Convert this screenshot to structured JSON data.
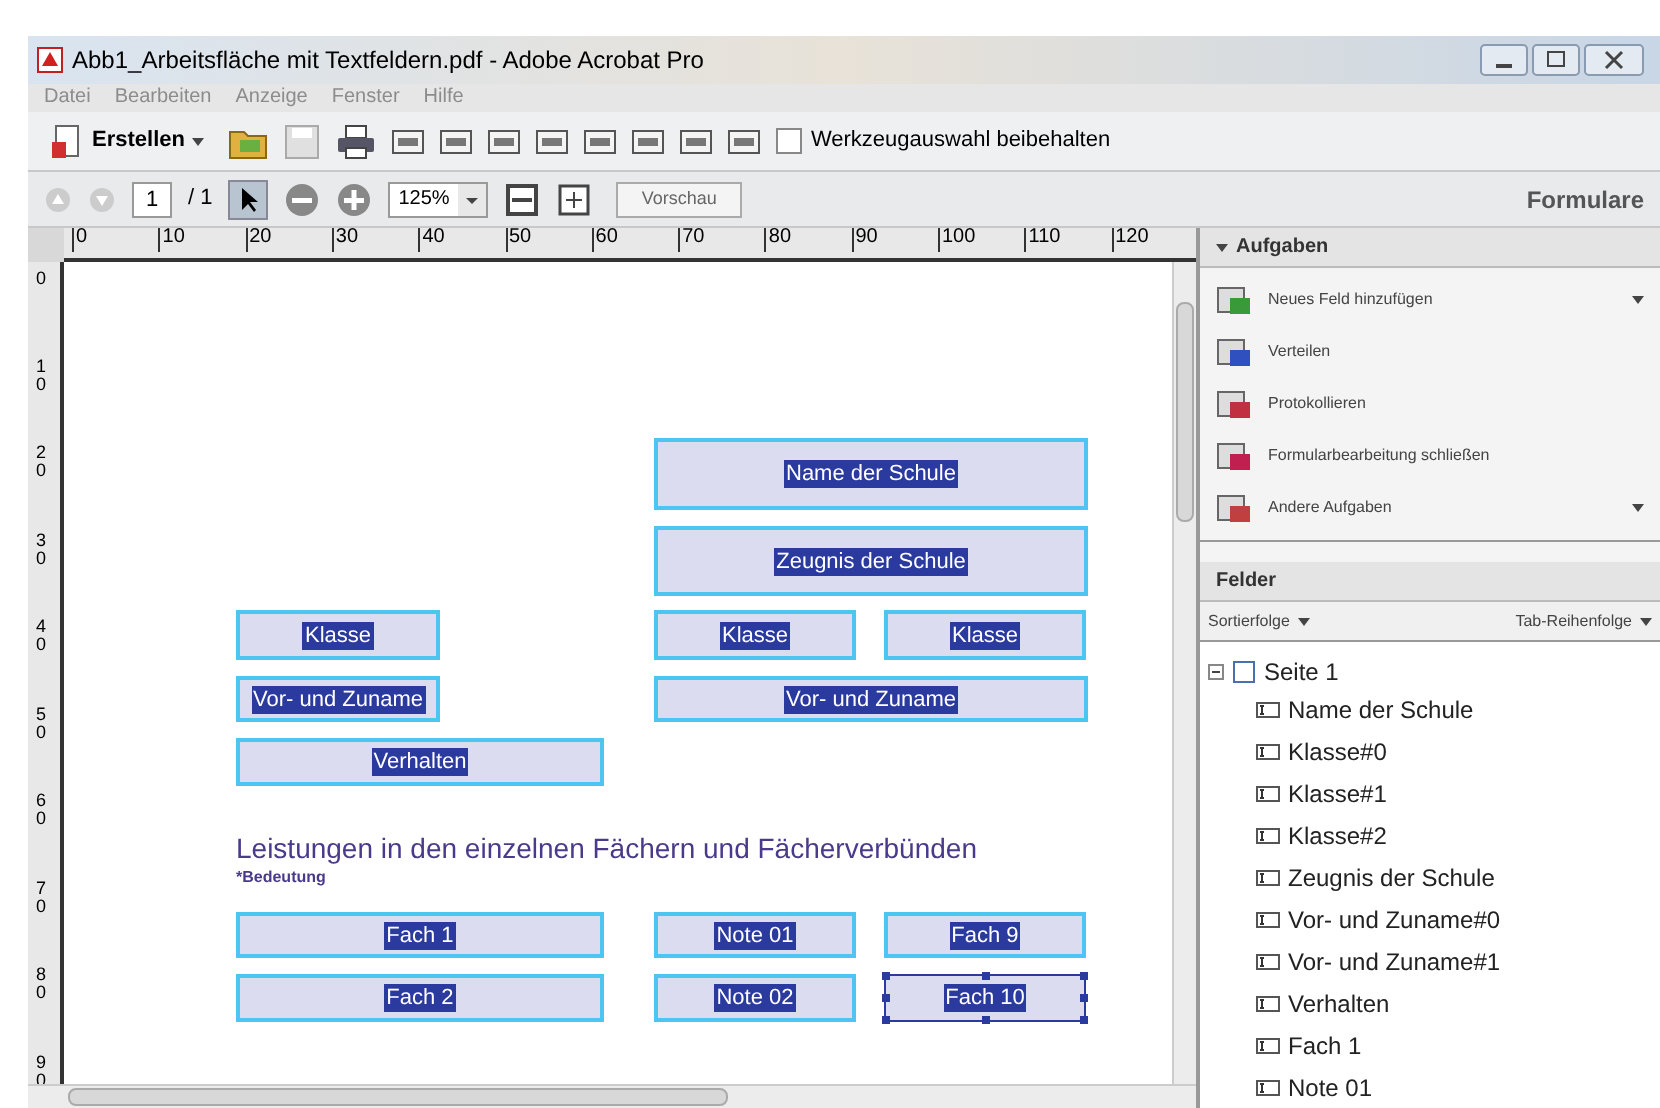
{
  "window": {
    "title": "Abb1_Arbeitsfläche mit Textfeldern.pdf - Adobe Acrobat Pro"
  },
  "menu": [
    {
      "label": "Datei",
      "disabled": true
    },
    {
      "label": "Bearbeiten",
      "disabled": true
    },
    {
      "label": "Anzeige",
      "disabled": true
    },
    {
      "label": "Fenster",
      "disabled": true
    },
    {
      "label": "Hilfe",
      "disabled": true
    }
  ],
  "toolbar": {
    "create_label": "Erstellen",
    "keep_tool": {
      "label": "Werkzeugauswahl beibehalten",
      "checked": false
    }
  },
  "navigation": {
    "page": "1",
    "page_total": "/ 1",
    "zoom": "125%",
    "preview": "Vorschau",
    "panel_title": "Formulare"
  },
  "ruler": {
    "horizontal": [
      "0",
      "10",
      "20",
      "30",
      "40",
      "50",
      "60",
      "70",
      "80",
      "90",
      "100",
      "110",
      "120"
    ],
    "vertical": [
      "0",
      "10",
      "20",
      "30",
      "40",
      "50",
      "60",
      "70",
      "80",
      "90"
    ]
  },
  "form_fields": [
    {
      "label": "Name der Schule",
      "selected": false
    },
    {
      "label": "Zeugnis der Schule",
      "selected": false
    },
    {
      "label": "Klasse",
      "selected": false
    },
    {
      "label": "Klasse",
      "selected": false
    },
    {
      "label": "Klasse",
      "selected": false
    },
    {
      "label": "Vor- und Zuname",
      "selected": false
    },
    {
      "label": "Vor- und Zuname",
      "selected": false
    },
    {
      "label": "Verhalten",
      "selected": false
    },
    {
      "label": "Fach 1",
      "selected": false
    },
    {
      "label": "Note 01",
      "selected": false
    },
    {
      "label": "Fach 9",
      "selected": false
    },
    {
      "label": "Fach 2",
      "selected": false
    },
    {
      "label": "Note 02",
      "selected": false
    },
    {
      "label": "Fach 10",
      "selected": true
    }
  ],
  "page_texts": {
    "heading": "Leistungen in den einzelnen Fächern und Fächerverbünden",
    "note": "*Bedeutung"
  },
  "tasks": {
    "title": "Aufgaben",
    "items": [
      {
        "label": "Neues Feld hinzufügen",
        "has_menu": true,
        "color": "#3a9a3a"
      },
      {
        "label": "Verteilen",
        "has_menu": false,
        "color": "#3050c0"
      },
      {
        "label": "Protokollieren",
        "has_menu": false,
        "color": "#c03040"
      },
      {
        "label": "Formularbearbeitung schließen",
        "has_menu": false,
        "color": "#c02050"
      },
      {
        "label": "Andere Aufgaben",
        "has_menu": true,
        "color": "#c04040"
      }
    ]
  },
  "fields_panel": {
    "title": "Felder",
    "sort": "Sortierfolge",
    "tab_order": "Tab-Reihenfolge",
    "tree": [
      {
        "label": "Seite 1",
        "expanded": true,
        "children": [
          {
            "label": "Name der Schule"
          },
          {
            "label": "Klasse#0"
          },
          {
            "label": "Klasse#1"
          },
          {
            "label": "Klasse#2"
          },
          {
            "label": "Zeugnis der Schule"
          },
          {
            "label": "Vor- und Zuname#0"
          },
          {
            "label": "Vor- und Zuname#1"
          },
          {
            "label": "Verhalten"
          },
          {
            "label": "Fach 1"
          },
          {
            "label": "Note 01"
          }
        ]
      }
    ]
  }
}
